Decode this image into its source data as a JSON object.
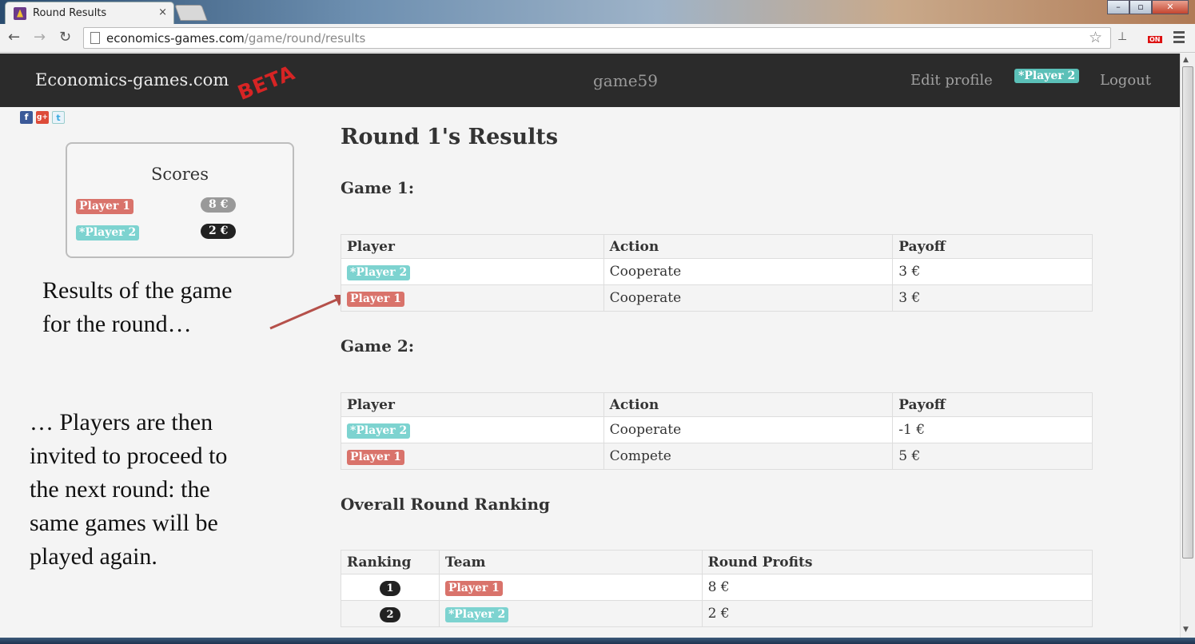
{
  "browser": {
    "tab_title": "Round Results",
    "tab_close": "×",
    "url_domain": "economics-games.com",
    "url_path": "/game/round/results",
    "back": "←",
    "forward": "→",
    "reload": "↻",
    "star": "☆",
    "ext_on_label": "ON",
    "window_min": "–",
    "window_max": "▫",
    "window_close": "✕"
  },
  "navbar": {
    "brand": "Economics-games.com",
    "beta": "BETA",
    "game_name": "game59",
    "edit_profile": "Edit profile",
    "player_badge": "*Player 2",
    "logout": "Logout"
  },
  "social": {
    "facebook": "f",
    "googleplus": "g+",
    "twitter": "t"
  },
  "scores": {
    "title": "Scores",
    "rows": [
      {
        "player": "Player 1",
        "score": "8 €"
      },
      {
        "player": "*Player 2",
        "score": "2 €"
      }
    ]
  },
  "annotations": {
    "first_line1": "Results of the game",
    "first_line2": "for the round…",
    "second_line1": "… Players are then",
    "second_line2": "invited to proceed to",
    "second_line3": "the next round: the",
    "second_line4": "same games will be",
    "second_line5": "played again."
  },
  "main": {
    "title": "Round 1's Results",
    "game1": {
      "heading": "Game 1:",
      "headers": [
        "Player",
        "Action",
        "Payoff"
      ],
      "rows": [
        {
          "player": "*Player 2",
          "action": "Cooperate",
          "payoff": "3 €"
        },
        {
          "player": "Player 1",
          "action": "Cooperate",
          "payoff": "3 €"
        }
      ]
    },
    "game2": {
      "heading": "Game 2:",
      "headers": [
        "Player",
        "Action",
        "Payoff"
      ],
      "rows": [
        {
          "player": "*Player 2",
          "action": "Cooperate",
          "payoff": "-1 €"
        },
        {
          "player": "Player 1",
          "action": "Compete",
          "payoff": "5 €"
        }
      ]
    },
    "ranking": {
      "heading": "Overall Round Ranking",
      "headers": [
        "Ranking",
        "Team",
        "Round Profits"
      ],
      "rows": [
        {
          "rank": "1",
          "team": "Player 1",
          "profit": "8 €"
        },
        {
          "rank": "2",
          "team": "*Player 2",
          "profit": "2 €"
        }
      ]
    }
  },
  "colors": {
    "player1": "#d9736b",
    "player2": "#7dd3d0",
    "navbar": "#2b2b2b",
    "beta": "#e02424",
    "arrow": "#b5504a"
  }
}
